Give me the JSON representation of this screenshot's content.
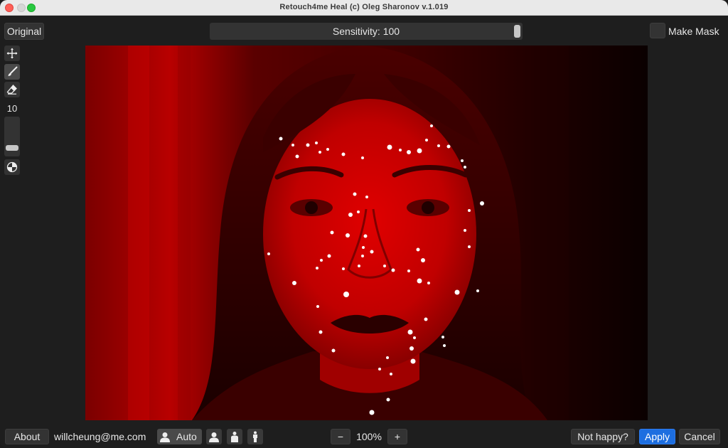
{
  "window": {
    "title": "Retouch4me Heal (c) Oleg Sharonov v.1.019"
  },
  "toolbar": {
    "original_label": "Original",
    "sensitivity_label": "Sensitivity: 100",
    "sensitivity_value": 100,
    "make_mask_label": "Make Mask",
    "make_mask_checked": false
  },
  "tools": {
    "brush_size": "10",
    "items": [
      "move-icon",
      "brush-icon",
      "eraser-icon",
      "overlay-toggle-icon"
    ]
  },
  "image": {
    "description_tint": "#c00000"
  },
  "bottom": {
    "about_label": "About",
    "email": "willcheung@me.com",
    "auto_label": "Auto",
    "zoom_minus": "−",
    "zoom_value": "100%",
    "zoom_plus": "+",
    "not_happy_label": "Not happy?",
    "apply_label": "Apply",
    "cancel_label": "Cancel"
  },
  "colors": {
    "accent": "#1d6ee0",
    "background": "#1e1e1e",
    "mask_tint": "#c00000"
  }
}
